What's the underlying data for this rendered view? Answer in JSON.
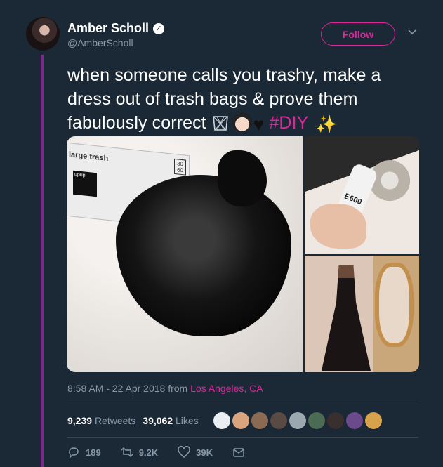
{
  "author": {
    "name": "Amber Scholl",
    "handle": "@AmberScholl",
    "verified": true
  },
  "follow_button": {
    "label": "Follow"
  },
  "tweet": {
    "text": "when someone calls you trashy, make a dress out of trash bags & prove them fabulously correct",
    "emojis": [
      "wastebasket-icon",
      "bride-with-veil-icon",
      "black-heart-icon"
    ],
    "hashtag": "#DIY",
    "trailing_emoji": "sparkles-icon"
  },
  "media": {
    "box_label": "large trash",
    "box_count_top": "30",
    "box_count_bottom": "60",
    "box_brand": "upup",
    "glue_label": "E600"
  },
  "meta": {
    "time": "8:58 AM - 22 Apr 2018",
    "from_label": "from",
    "location": "Los Angeles, CA"
  },
  "stats": {
    "retweets_count": "9,239",
    "retweets_label": "Retweets",
    "likes_count": "39,062",
    "likes_label": "Likes"
  },
  "actions": {
    "reply_count": "189",
    "retweet_count": "9.2K",
    "like_count": "39K"
  },
  "colors": {
    "background": "#1b2836",
    "accent": "#e0249a",
    "muted": "#8899a6",
    "thread_line": "#7b2a8c"
  }
}
